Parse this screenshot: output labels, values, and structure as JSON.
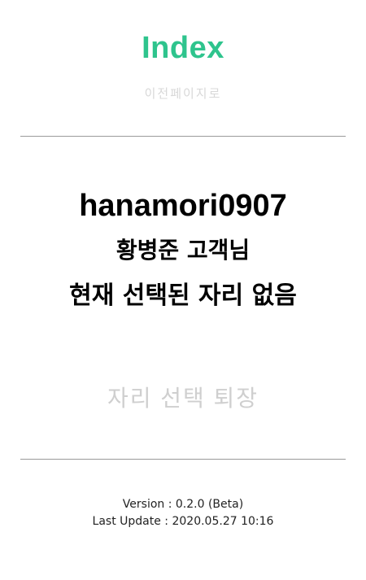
{
  "header": {
    "title": "Index",
    "back_link": "이전페이지로"
  },
  "user": {
    "id": "hanamori0907",
    "customer_line": "황병준 고객님",
    "seat_status": "현재 선택된 자리 없음"
  },
  "actions": {
    "checkout_label": "자리 선택 퇴장"
  },
  "footer": {
    "version": "Version : 0.2.0 (Beta)",
    "last_update": "Last Update : 2020.05.27 10:16"
  },
  "colors": {
    "title_accent": "#2ec48d",
    "muted_text": "#d8d8d8",
    "divider": "#9a9a9a"
  }
}
